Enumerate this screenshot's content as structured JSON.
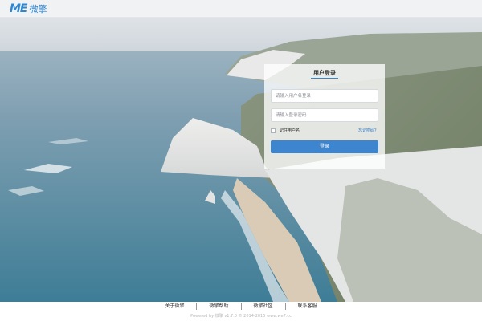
{
  "app": {
    "logo_mark": "ME",
    "logo_text": "微擎"
  },
  "login": {
    "title": "用户登录",
    "username_placeholder": "请输入用户名登录",
    "password_placeholder": "请输入登录密码",
    "remember_label": "记住用户名",
    "forgot_label": "忘记密码？",
    "submit_label": "登录"
  },
  "footer": {
    "links": [
      "关于微擎",
      "微擎帮助",
      "微擎社区",
      "联系客服"
    ],
    "copyright": "Powered by 微擎 v1.7.0 © 2014-2015 www.we7.cc"
  },
  "colors": {
    "accent": "#3d86cf",
    "link": "#2e78c7",
    "logo": "#2e86d0"
  }
}
